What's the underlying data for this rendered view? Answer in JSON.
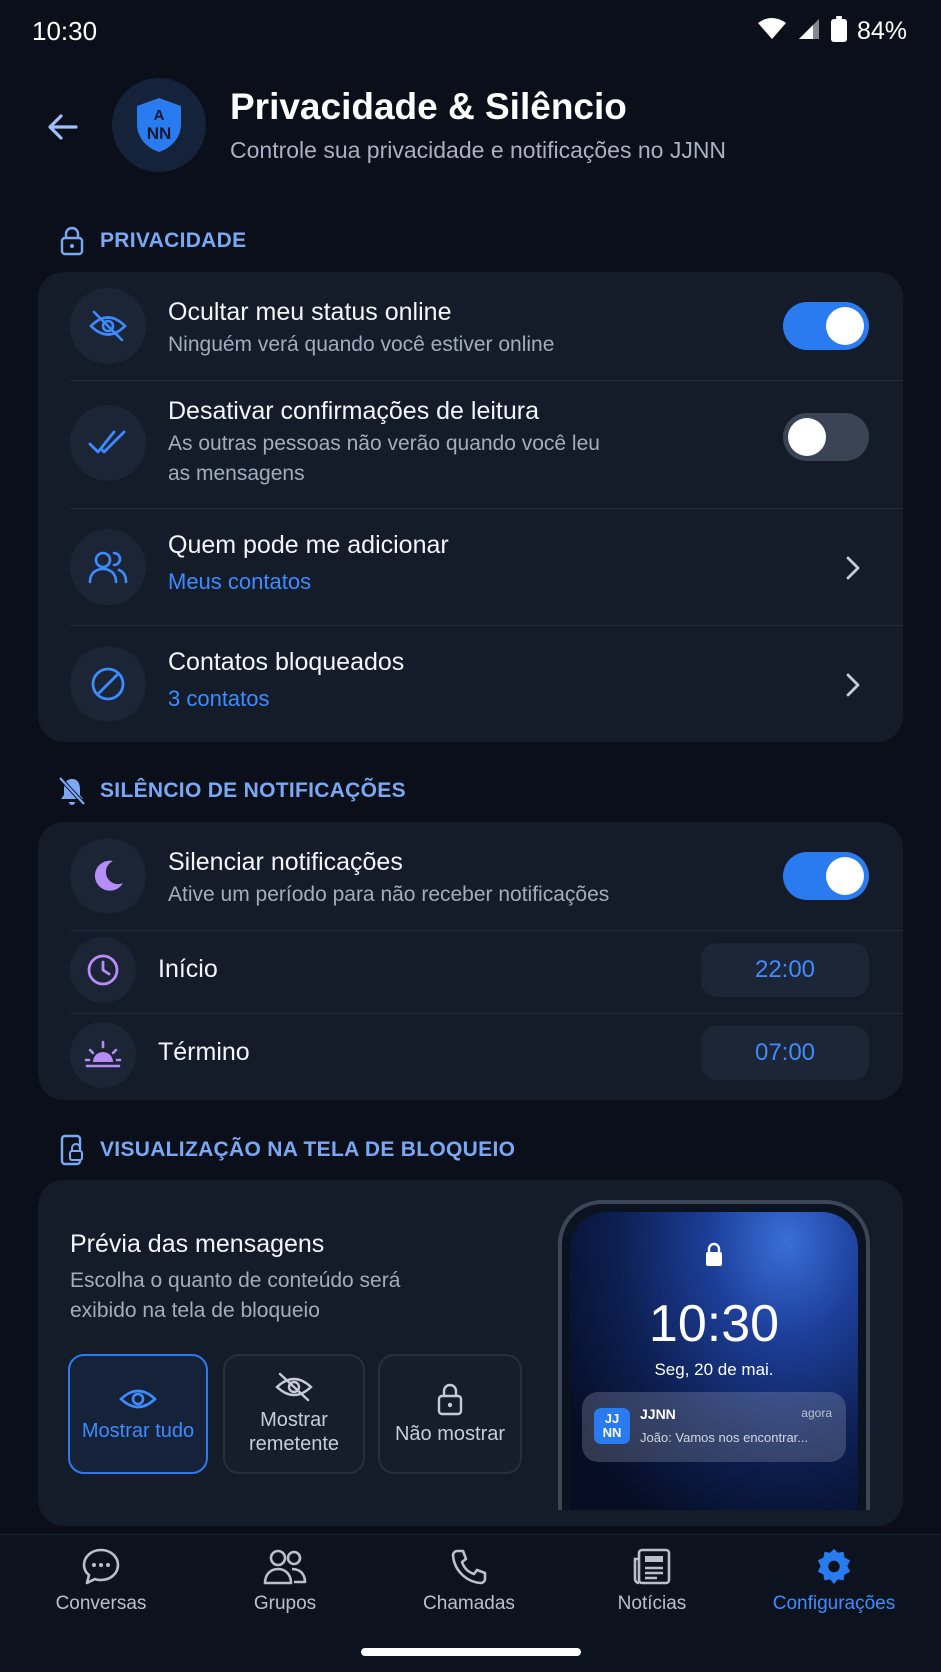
{
  "status_bar": {
    "time": "10:30",
    "battery": "84%"
  },
  "header": {
    "title": "Privacidade & Silêncio",
    "subtitle": "Controle sua privacidade e notificações no JJNN",
    "logo_text_top": "A",
    "logo_text_bottom": "NN"
  },
  "privacy": {
    "section_label": "PRIVACIDADE",
    "rows": [
      {
        "title": "Ocultar meu status online",
        "subtitle": "Ninguém verá quando você estiver online",
        "toggle": true,
        "icon": "eye-off-icon"
      },
      {
        "title": "Desativar confirmações de leitura",
        "subtitle_line1": "As outras pessoas não verão quando você leu",
        "subtitle_line2": "as mensagens",
        "toggle": false,
        "icon": "double-check-icon"
      },
      {
        "title": "Quem pode me adicionar",
        "value": "Meus contatos",
        "icon": "users-icon"
      },
      {
        "title": "Contatos bloqueados",
        "value": "3 contatos",
        "icon": "block-icon"
      }
    ]
  },
  "silence": {
    "section_label": "SILÊNCIO DE NOTIFICAÇÕES",
    "mute": {
      "title": "Silenciar notificações",
      "subtitle": "Ative um período para não receber notificações",
      "toggle": true
    },
    "start": {
      "label": "Início",
      "value": "22:00"
    },
    "end": {
      "label": "Término",
      "value": "07:00"
    }
  },
  "lockscreen": {
    "section_label": "VISUALIZAÇÃO NA TELA DE BLOQUEIO",
    "title": "Prévia das mensagens",
    "subtitle_line1": "Escolha o quanto de conteúdo será",
    "subtitle_line2": "exibido na tela de bloqueio",
    "options": [
      {
        "label": "Mostrar tudo",
        "selected": true
      },
      {
        "label_line1": "Mostrar",
        "label_line2": "remetente",
        "selected": false
      },
      {
        "label": "Não mostrar",
        "selected": false
      }
    ],
    "phone": {
      "time": "10:30",
      "date": "Seg, 20 de mai.",
      "notification": {
        "logo_top": "JJ",
        "logo_bottom": "NN",
        "app": "JJNN",
        "time": "agora",
        "message": "João: Vamos nos encontrar..."
      }
    }
  },
  "bottom_nav": {
    "items": [
      {
        "label": "Conversas",
        "icon": "chat-icon"
      },
      {
        "label": "Grupos",
        "icon": "groups-icon"
      },
      {
        "label": "Chamadas",
        "icon": "phone-icon"
      },
      {
        "label": "Notícias",
        "icon": "news-icon"
      },
      {
        "label": "Configurações",
        "icon": "settings-icon",
        "active": true
      }
    ]
  },
  "colors": {
    "accent": "#2a7bf0",
    "link": "#3d8cff",
    "section": "#7aa8f5",
    "purple": "#a97bf2",
    "background": "#0a0f19",
    "card": "#141c2a"
  }
}
